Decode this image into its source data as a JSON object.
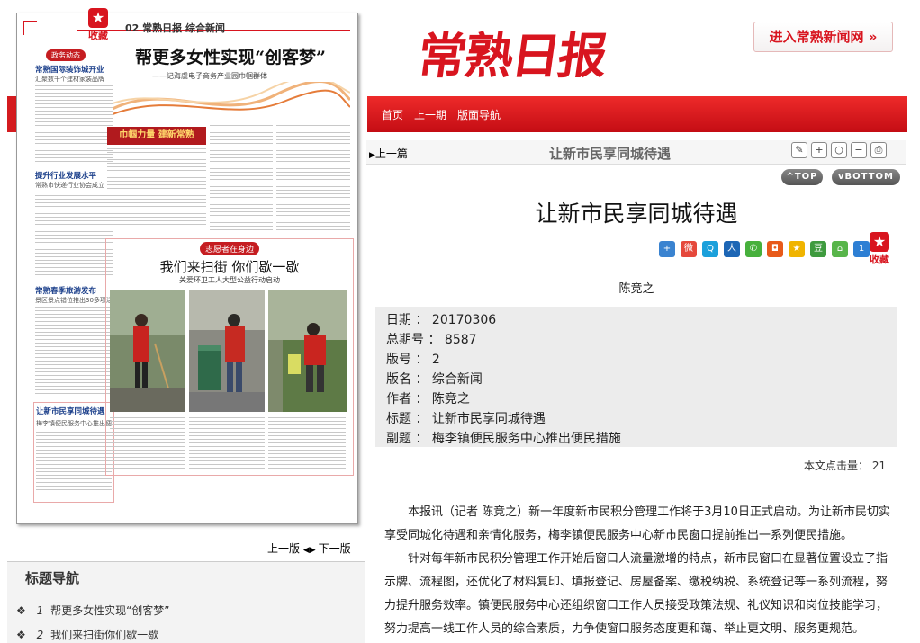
{
  "header": {
    "masthead": "常熟日报",
    "enter_site": "进入常熟新闻网",
    "nav": [
      "首页",
      "上一期",
      "版面导航"
    ]
  },
  "paper": {
    "favorite_label": "收藏",
    "edition_line": "02 常熟日报 综合新闻",
    "headline": "帮更多女性实现“创客梦”",
    "subheadline": "——记海虞电子商务产业园巾帼群体",
    "brief_tag": "政务动态",
    "brief1_title": "常熟国际装饰城开业",
    "brief1_sub": "汇聚数千个建材家装品牌",
    "brief2_title": "提升行业发展水平",
    "brief2_sub": "常熟市快递行业协会成立",
    "brief3_title": "常熟春季旅游发布",
    "brief3_sub": "景区景点错位推出30多项活动",
    "brief4_title": "让新市民享同城待遇",
    "brief4_sub": "梅李镇便民服务中心推出便民措施",
    "banner": "巾帼力量 建新常熟",
    "volunteer_tag": "志愿者在身边",
    "feature_title": "我们来扫街 你们歇一歇",
    "feature_sub": "关爱环卫工人大型公益行动启动"
  },
  "pager": {
    "prev": "上一版",
    "next": "下一版"
  },
  "title_nav": {
    "heading": "标题导航",
    "items": [
      {
        "num": "1",
        "text": "帮更多女性实现“创客梦”"
      },
      {
        "num": "2",
        "text": "我们来扫街你们歇一歇"
      }
    ]
  },
  "article_bar": {
    "prev": "上一篇",
    "title": "让新市民享同城待遇",
    "top_btn": "TOP",
    "bottom_btn": "BOTTOM"
  },
  "article": {
    "title": "让新市民享同城待遇",
    "favorite_label": "收藏",
    "author": "陈竞之",
    "meta": [
      {
        "label": "日期 ：",
        "value": "20170306"
      },
      {
        "label": "总期号 ：",
        "value": "8587"
      },
      {
        "label": "版号 ：",
        "value": "2"
      },
      {
        "label": "版名 ：",
        "value": "综合新闻"
      },
      {
        "label": "作者 ：",
        "value": "陈竞之"
      },
      {
        "label": "标题 ：",
        "value": "让新市民享同城待遇"
      },
      {
        "label": "副题 ：",
        "value": "梅李镇便民服务中心推出便民措施"
      }
    ],
    "clicks_label": "本文点击量：",
    "clicks_value": "21",
    "paragraphs": [
      "本报讯（记者 陈竞之）新一年度新市民积分管理工作将于3月10日正式启动。为让新市民切实享受同城化待遇和亲情化服务，梅李镇便民服务中心新市民窗口提前推出一系列便民措施。",
      "针对每年新市民积分管理工作开始后窗口人流量激增的特点，新市民窗口在显著位置设立了指示牌、流程图，还优化了材料复印、填报登记、房屋备案、缴税纳税、系统登记等一系列流程，努力提升服务效率。镇便民服务中心还组织窗口工作人员接受政策法规、礼仪知识和岗位技能学习，努力提高一线工作人员的综合素质，力争使窗口服务态度更和蔼、举止更文明、服务更规范。"
    ]
  },
  "colors": {
    "brand_red": "#d8151f",
    "meta_bg": "#ececec"
  },
  "icons": {
    "toolbar": [
      "edit-icon",
      "zoom-in-icon",
      "zoom-reset-icon",
      "zoom-out-icon",
      "print-icon"
    ],
    "share": [
      "share-plus-icon",
      "weibo-icon",
      "qzone-icon",
      "renren-icon",
      "wechat-icon",
      "share-box-icon",
      "star-share-icon",
      "douban-icon",
      "kaixin-icon",
      "count-icon"
    ]
  }
}
